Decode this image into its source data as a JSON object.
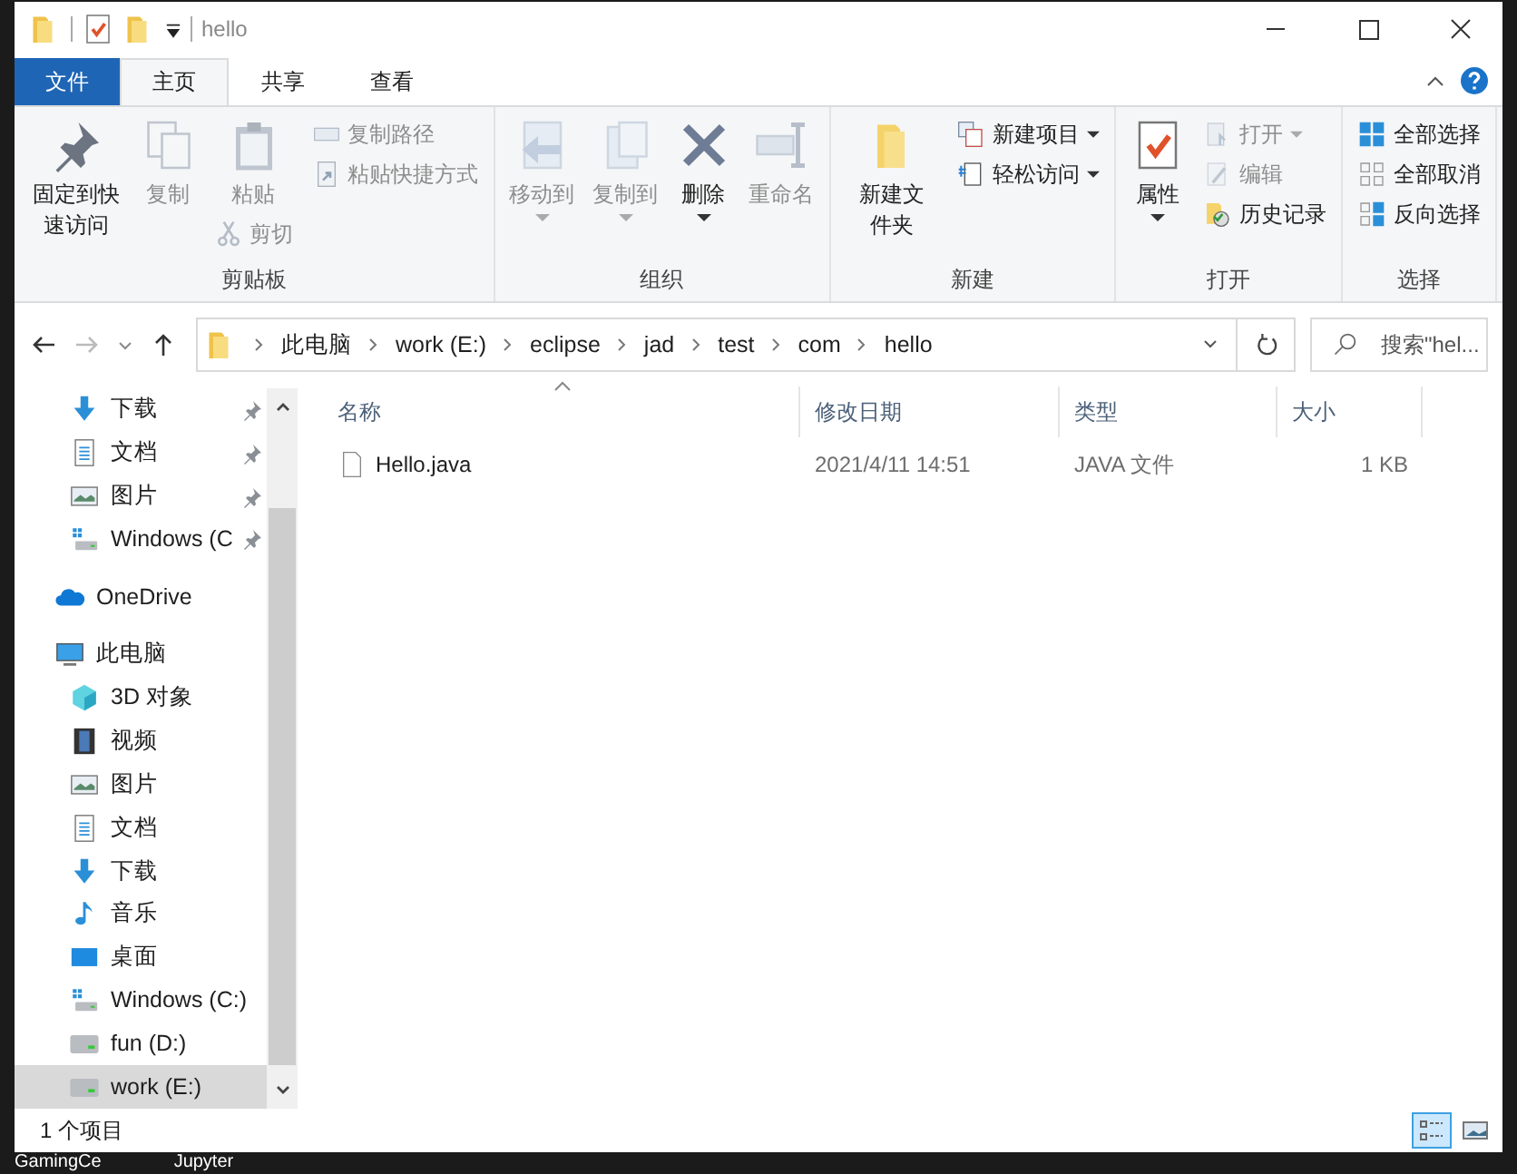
{
  "window": {
    "title": "hello"
  },
  "ribbon_tabs": [
    {
      "label": "文件",
      "kind": "file",
      "selected": false
    },
    {
      "label": "主页",
      "kind": "tab",
      "selected": true
    },
    {
      "label": "共享",
      "kind": "tab",
      "selected": false
    },
    {
      "label": "查看",
      "kind": "tab",
      "selected": false
    }
  ],
  "ribbon_groups": [
    {
      "label": "剪贴板",
      "columns": [
        [
          {
            "kind": "large",
            "label": "固定到快速访问",
            "disabled": false,
            "dropdown": false
          }
        ],
        [
          {
            "kind": "large",
            "label": "复制",
            "disabled": true,
            "dropdown": false
          }
        ],
        [
          {
            "kind": "large",
            "label": "粘贴",
            "disabled": true,
            "dropdown": false
          },
          {
            "kind": "small",
            "label": "剪切",
            "disabled": true,
            "dropdown": false
          }
        ],
        [
          {
            "kind": "small",
            "label": "复制路径",
            "disabled": true,
            "dropdown": false
          },
          {
            "kind": "small",
            "label": "粘贴快捷方式",
            "disabled": true,
            "dropdown": false
          }
        ]
      ]
    },
    {
      "label": "组织",
      "columns": [
        [
          {
            "kind": "large",
            "label": "移动到",
            "disabled": true,
            "dropdown": true
          }
        ],
        [
          {
            "kind": "large",
            "label": "复制到",
            "disabled": true,
            "dropdown": true
          }
        ],
        [
          {
            "kind": "large",
            "label": "删除",
            "disabled": false,
            "dropdown": true
          }
        ],
        [
          {
            "kind": "large",
            "label": "重命名",
            "disabled": true,
            "dropdown": false
          }
        ]
      ]
    },
    {
      "label": "新建",
      "columns": [
        [
          {
            "kind": "large",
            "label": "新建文件夹",
            "disabled": false,
            "dropdown": false
          }
        ],
        [
          {
            "kind": "small",
            "label": "新建项目",
            "disabled": false,
            "dropdown": true
          },
          {
            "kind": "small",
            "label": "轻松访问",
            "disabled": false,
            "dropdown": true
          }
        ]
      ]
    },
    {
      "label": "打开",
      "columns": [
        [
          {
            "kind": "large",
            "label": "属性",
            "disabled": false,
            "dropdown": true
          }
        ],
        [
          {
            "kind": "small",
            "label": "打开",
            "disabled": true,
            "dropdown": true
          },
          {
            "kind": "small",
            "label": "编辑",
            "disabled": true,
            "dropdown": false
          },
          {
            "kind": "small",
            "label": "历史记录",
            "disabled": false,
            "dropdown": false
          }
        ]
      ]
    },
    {
      "label": "选择",
      "columns": [
        [
          {
            "kind": "small",
            "label": "全部选择",
            "disabled": false,
            "dropdown": false
          },
          {
            "kind": "small",
            "label": "全部取消",
            "disabled": false,
            "dropdown": false
          },
          {
            "kind": "small",
            "label": "反向选择",
            "disabled": false,
            "dropdown": false
          }
        ]
      ]
    }
  ],
  "address": {
    "breadcrumbs": [
      "此电脑",
      "work (E:)",
      "eclipse",
      "jad",
      "test",
      "com",
      "hello"
    ]
  },
  "search": {
    "placeholder": "搜索\"hel..."
  },
  "nav": {
    "items": [
      {
        "label": "下载",
        "kind": "quick",
        "pinned": true,
        "selected": false
      },
      {
        "label": "文档",
        "kind": "quick",
        "pinned": true,
        "selected": false
      },
      {
        "label": "图片",
        "kind": "quick",
        "pinned": true,
        "selected": false
      },
      {
        "label": "Windows (C",
        "kind": "quick",
        "pinned": true,
        "selected": false
      },
      {
        "label": "OneDrive",
        "kind": "root",
        "selected": false
      },
      {
        "label": "此电脑",
        "kind": "root",
        "selected": false,
        "children": [
          {
            "label": "3D 对象",
            "selected": false
          },
          {
            "label": "视频",
            "selected": false
          },
          {
            "label": "图片",
            "selected": false
          },
          {
            "label": "文档",
            "selected": false
          },
          {
            "label": "下载",
            "selected": false
          },
          {
            "label": "音乐",
            "selected": false
          },
          {
            "label": "桌面",
            "selected": false
          },
          {
            "label": "Windows (C:)",
            "selected": false
          },
          {
            "label": "fun (D:)",
            "selected": false
          },
          {
            "label": "work (E:)",
            "selected": true
          }
        ]
      }
    ]
  },
  "file_list": {
    "columns": [
      "名称",
      "修改日期",
      "类型",
      "大小"
    ],
    "rows": [
      {
        "cells": [
          "Hello.java",
          "2021/4/11 14:51",
          "JAVA 文件",
          "1 KB"
        ],
        "selected": false
      }
    ]
  },
  "status_bar": {
    "item_count": "1 个项目",
    "view_buttons": [
      {
        "kind": "details",
        "selected": true
      },
      {
        "kind": "tiles",
        "selected": false
      }
    ]
  },
  "desktop_icons": [
    {
      "label": "GamingCe"
    },
    {
      "label": "Jupyter"
    }
  ]
}
